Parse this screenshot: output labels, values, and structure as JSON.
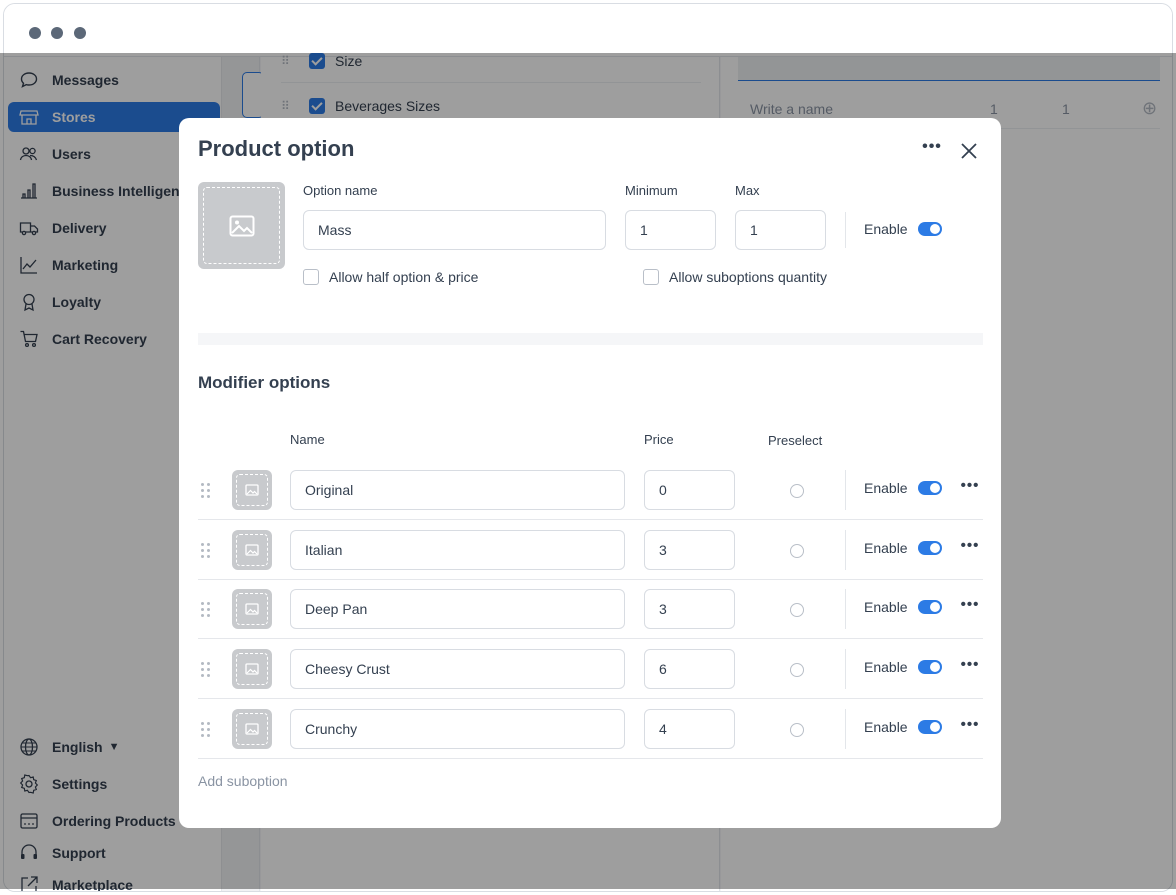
{
  "window": {
    "controls": [
      "close",
      "minimize",
      "maximize"
    ]
  },
  "sidebar": {
    "items": [
      {
        "label": "Messages",
        "icon": "chat-bubble-icon",
        "active": false
      },
      {
        "label": "Stores",
        "icon": "store-icon",
        "active": true
      },
      {
        "label": "Users",
        "icon": "users-icon",
        "active": false
      },
      {
        "label": "Business Intelligence",
        "icon": "bar-chart-icon",
        "active": false
      },
      {
        "label": "Delivery",
        "icon": "truck-icon",
        "active": false
      },
      {
        "label": "Marketing",
        "icon": "line-chart-icon",
        "active": false
      },
      {
        "label": "Loyalty",
        "icon": "award-icon",
        "active": false
      },
      {
        "label": "Cart Recovery",
        "icon": "cart-icon",
        "active": false
      }
    ],
    "bottom_items": [
      {
        "label": "English",
        "icon": "globe-icon",
        "has_caret": true
      },
      {
        "label": "Settings",
        "icon": "gear-icon"
      },
      {
        "label": "Ordering Products",
        "icon": "calendar-icon"
      },
      {
        "label": "Support",
        "icon": "headset-icon"
      },
      {
        "label": "Marketplace",
        "icon": "external-link-icon"
      }
    ]
  },
  "background": {
    "option_rows": [
      "Size",
      "Beverages Sizes"
    ],
    "write_placeholder": "Write a name",
    "write_min": "1",
    "write_max": "1"
  },
  "modal": {
    "title": "Product option",
    "option_name_label": "Option name",
    "option_name_value": "Mass",
    "minimum_label": "Minimum",
    "minimum_value": "1",
    "max_label": "Max",
    "max_value": "1",
    "enable_label": "Enable",
    "enabled": true,
    "allow_half_label": "Allow half option & price",
    "allow_half_checked": false,
    "allow_suboptions_label": "Allow suboptions quantity",
    "allow_suboptions_checked": false,
    "modifier_title": "Modifier options",
    "columns": {
      "name": "Name",
      "price": "Price",
      "preselect": "Preselect"
    },
    "modifiers": [
      {
        "name": "Original",
        "price": "0",
        "preselect": false,
        "enable_label": "Enable",
        "enabled": true
      },
      {
        "name": "Italian",
        "price": "3",
        "preselect": false,
        "enable_label": "Enable",
        "enabled": true
      },
      {
        "name": "Deep Pan",
        "price": "3",
        "preselect": false,
        "enable_label": "Enable",
        "enabled": true
      },
      {
        "name": "Cheesy Crust",
        "price": "6",
        "preselect": false,
        "enable_label": "Enable",
        "enabled": true
      },
      {
        "name": "Crunchy",
        "price": "4",
        "preselect": false,
        "enable_label": "Enable",
        "enabled": true
      }
    ],
    "add_suboption_label": "Add suboption"
  },
  "colors": {
    "accent": "#2c7be5",
    "text": "#344050",
    "muted": "#8a94a3",
    "placeholder_gray": "#c8cacd"
  }
}
